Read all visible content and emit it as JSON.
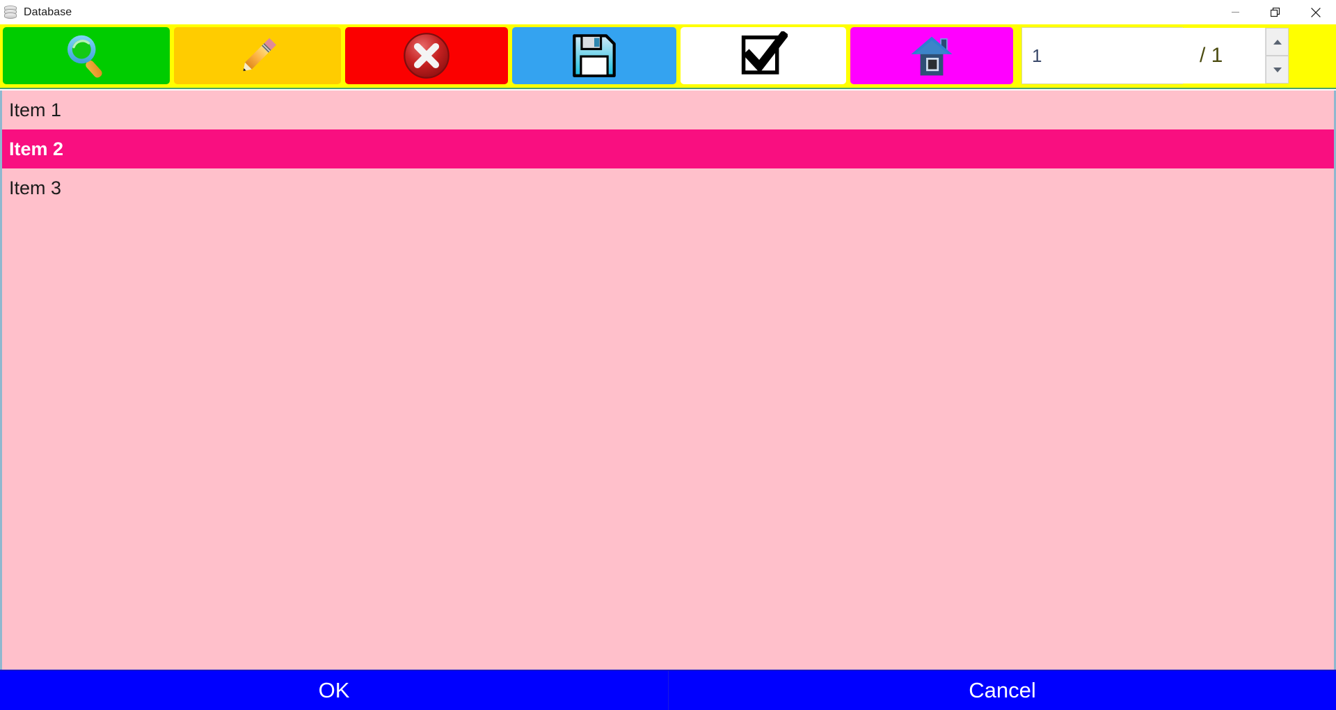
{
  "window": {
    "title": "Database",
    "icon": "database-icon",
    "controls": {
      "minimize": "minimize-icon",
      "restore": "restore-icon",
      "close": "close-icon"
    }
  },
  "toolbar": {
    "background_color": "#ffff00",
    "buttons": [
      {
        "name": "search-button",
        "icon": "magnifier-icon",
        "color": "#00cc00",
        "label": ""
      },
      {
        "name": "edit-button",
        "icon": "pencil-icon",
        "color": "#ffcc00",
        "label": ""
      },
      {
        "name": "delete-button",
        "icon": "delete-x-icon",
        "color": "#fb0000",
        "label": ""
      },
      {
        "name": "save-button",
        "icon": "floppy-disk-icon",
        "color": "#34a3f0",
        "label": ""
      },
      {
        "name": "confirm-button",
        "icon": "checkbox-icon",
        "color": "#ffffff",
        "label": ""
      },
      {
        "name": "home-button",
        "icon": "house-icon",
        "color": "#ff00ff",
        "label": ""
      }
    ],
    "pager": {
      "value": "1",
      "placeholder": "",
      "total_label": "/ 1",
      "up_icon": "triangle-up-icon",
      "down_icon": "triangle-down-icon"
    }
  },
  "list": {
    "background_color": "#ffc0cb",
    "selected_color": "#f90f80",
    "items": [
      {
        "label": "Item 1",
        "selected": false
      },
      {
        "label": "Item 2",
        "selected": true
      },
      {
        "label": "Item 3",
        "selected": false
      }
    ]
  },
  "footer": {
    "background_color": "#0000ff",
    "ok_label": "OK",
    "cancel_label": "Cancel"
  }
}
